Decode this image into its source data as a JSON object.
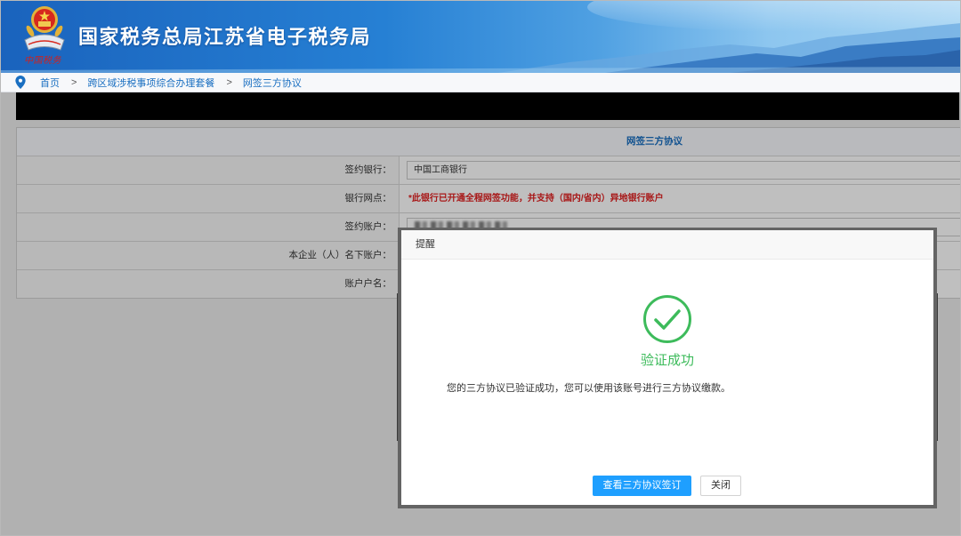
{
  "header": {
    "title": "国家税务总局江苏省电子税务局",
    "logo_text": "中国税务"
  },
  "breadcrumb": {
    "items": [
      "首页",
      "跨区域涉税事项综合办理套餐",
      "网签三方协议"
    ],
    "separator": ">"
  },
  "form": {
    "title": "网签三方协议",
    "rows": [
      {
        "label": "签约银行：",
        "value": "中国工商银行"
      },
      {
        "label": "银行网点：",
        "notice": "*此银行已开通全程网签功能，并支持（国内/省内）异地银行账户"
      },
      {
        "label": "签约账户："
      },
      {
        "label": "本企业（人）名下账户："
      },
      {
        "label": "账户户名："
      }
    ]
  },
  "dialog": {
    "title": "提醒",
    "status": "验证成功",
    "message": "您的三方协议已验证成功，您可以使用该账号进行三方协议缴款。",
    "primary_button": "查看三方协议签订",
    "close_button": "关闭"
  },
  "icons": {
    "logo": "tax-emblem-icon",
    "breadcrumb": "location-pin-icon",
    "dialog_status": "check-circle-icon"
  },
  "colors": {
    "link_blue": "#1a6fc1",
    "notice_red": "#e02020",
    "success_green": "#3dbb5b",
    "primary_button": "#1e9fff",
    "header_blue": "#1a63bd"
  }
}
